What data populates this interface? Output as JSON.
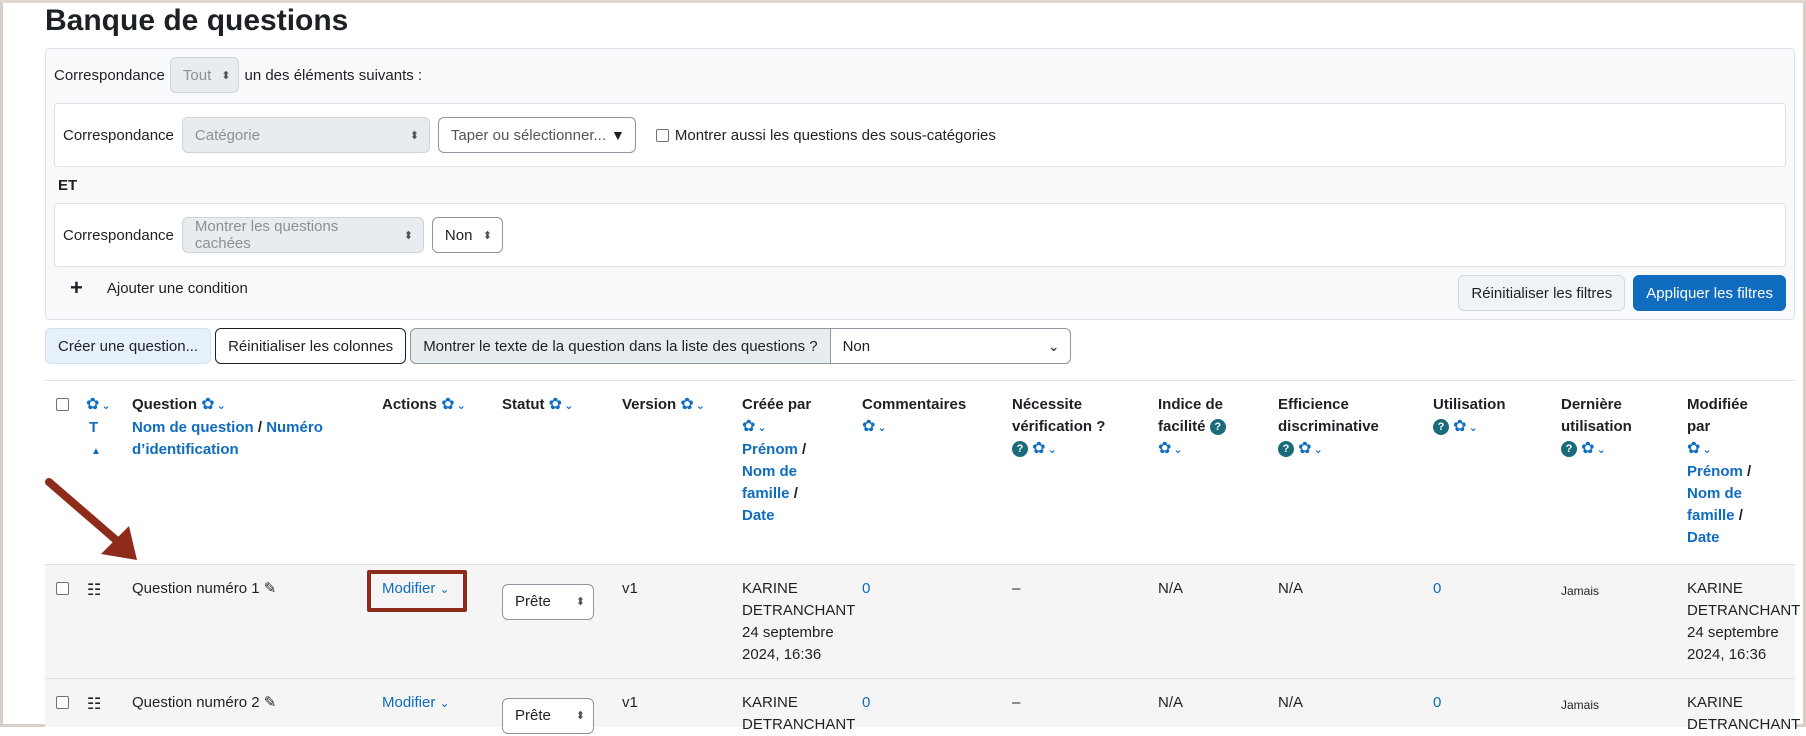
{
  "page_title": "Banque de questions",
  "filter": {
    "match_label": "Correspondance",
    "match_value": "Tout",
    "match_suffix": "un des éléments suivants :",
    "cond1": {
      "label": "Correspondance",
      "type_value": "Catégorie",
      "value_placeholder": "Taper ou sélectionner...",
      "subcat_label": "Montrer aussi les questions des sous-catégories"
    },
    "and_label": "ET",
    "cond2": {
      "label": "Correspondance",
      "type_value": "Montrer les questions cachées",
      "value": "Non"
    },
    "add_condition": "Ajouter une condition",
    "reset_filters": "Réinitialiser les filtres",
    "apply_filters": "Appliquer les filtres"
  },
  "toolbar": {
    "create_question": "Créer une question...",
    "reset_columns": "Réinitialiser les colonnes",
    "show_text_label": "Montrer le texte de la question dans la liste des questions ?",
    "show_text_value": "Non"
  },
  "table": {
    "headers": {
      "type": "T",
      "question": "Question",
      "question_name": "Nom de question",
      "slash": " / ",
      "question_id": "Numéro d’identification",
      "actions": "Actions",
      "status": "Statut",
      "version": "Version",
      "created_by": "Créée par",
      "first_name": "Prénom",
      "last_name_1": "Nom de",
      "last_name_2": "famille",
      "date": "Date",
      "comments": "Commentaires",
      "needs_check_1": "Nécessite",
      "needs_check_2": "vérification ?",
      "facility_1": "Indice de",
      "facility_2": "facilité",
      "discrim_1": "Efficience",
      "discrim_2": "discriminative",
      "usage": "Utilisation",
      "last_used_1": "Dernière",
      "last_used_2": "utilisation",
      "modified_by_1": "Modifiée",
      "modified_by_2": "par"
    },
    "rows": [
      {
        "name": "Question numéro 1",
        "action": "Modifier",
        "status": "Prête",
        "version": "v1",
        "creator_1": "KARINE",
        "creator_2": "DETRANCHANT",
        "creator_date_1": "24 septembre",
        "creator_date_2": "2024, 16:36",
        "comments": "0",
        "needs_check": "–",
        "facility": "N/A",
        "discrimination": "N/A",
        "usage": "0",
        "last_used": "Jamais",
        "modifier_1": "KARINE",
        "modifier_2": "DETRANCHANT",
        "modifier_date_1": "24 septembre",
        "modifier_date_2": "2024, 16:36"
      },
      {
        "name": "Question numéro 2",
        "action": "Modifier",
        "status": "Prête",
        "version": "v1",
        "creator_1": "KARINE",
        "creator_2": "DETRANCHANT",
        "comments": "0",
        "needs_check": "–",
        "facility": "N/A",
        "discrimination": "N/A",
        "usage": "0",
        "last_used": "Jamais",
        "modifier_1": "KARINE",
        "modifier_2": "DETRANCHANT"
      }
    ]
  },
  "colors": {
    "primary": "#0f6cbf",
    "annotation": "#8e2b1a"
  }
}
